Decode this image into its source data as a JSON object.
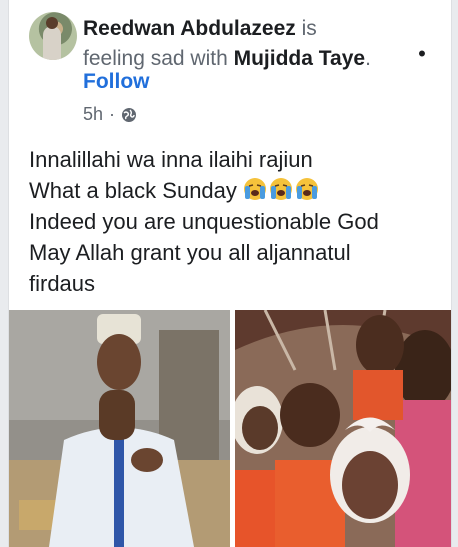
{
  "post": {
    "author": "Reedwan Abdulazeez",
    "activity_is": "is",
    "activity_feeling": "feeling sad with",
    "tagged": "Mujidda Taye",
    "period": ".",
    "follow_label": "Follow",
    "time": "5h",
    "separator": "·",
    "privacy_icon": "globe-icon",
    "menu_icon": "more-dots-icon",
    "text": {
      "line1": "Innalillahi wa inna ilaihi rajiun",
      "line2": "What a black Sunday",
      "line3": "Indeed you are unquestionable God",
      "line4": "May Allah grant you all aljannatul",
      "line5": "firdaus"
    },
    "emoji": "loudly-crying-face",
    "emoji_count": 3
  },
  "colors": {
    "link_blue": "#216fdb",
    "secondary_text": "#606770",
    "primary_text": "#1c1e21"
  }
}
